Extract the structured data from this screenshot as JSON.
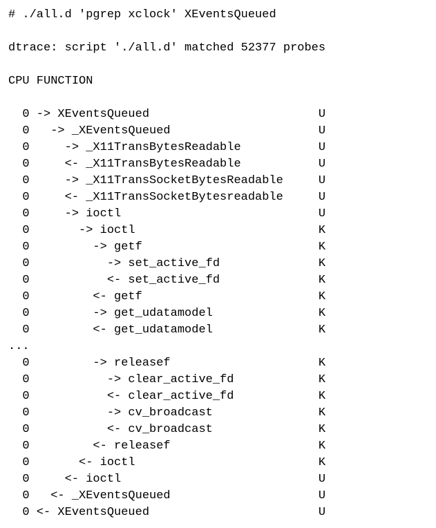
{
  "command_line": "# ./all.d 'pgrep xclock' XEventsQueued",
  "dtrace_line": "dtrace: script './all.d' matched 52377 probes",
  "header": "CPU FUNCTION",
  "ellipsis": "...",
  "trace_rows": [
    {
      "cpu": "0",
      "dir": "->",
      "depth": 0,
      "name": "XEventsQueued",
      "tag": "U"
    },
    {
      "cpu": "0",
      "dir": "->",
      "depth": 1,
      "name": "_XEventsQueued",
      "tag": "U"
    },
    {
      "cpu": "0",
      "dir": "->",
      "depth": 2,
      "name": "_X11TransBytesReadable",
      "tag": "U"
    },
    {
      "cpu": "0",
      "dir": "<-",
      "depth": 2,
      "name": "_X11TransBytesReadable",
      "tag": "U"
    },
    {
      "cpu": "0",
      "dir": "->",
      "depth": 2,
      "name": "_X11TransSocketBytesReadable",
      "tag": "U"
    },
    {
      "cpu": "0",
      "dir": "<-",
      "depth": 2,
      "name": "_X11TransSocketBytesreadable",
      "tag": "U"
    },
    {
      "cpu": "0",
      "dir": "->",
      "depth": 2,
      "name": "ioctl",
      "tag": "U"
    },
    {
      "cpu": "0",
      "dir": "->",
      "depth": 3,
      "name": "ioctl",
      "tag": "K"
    },
    {
      "cpu": "0",
      "dir": "->",
      "depth": 4,
      "name": "getf",
      "tag": "K"
    },
    {
      "cpu": "0",
      "dir": "->",
      "depth": 5,
      "name": "set_active_fd",
      "tag": "K"
    },
    {
      "cpu": "0",
      "dir": "<-",
      "depth": 5,
      "name": "set_active_fd",
      "tag": "K"
    },
    {
      "cpu": "0",
      "dir": "<-",
      "depth": 4,
      "name": "getf",
      "tag": "K"
    },
    {
      "cpu": "0",
      "dir": "->",
      "depth": 4,
      "name": "get_udatamodel",
      "tag": "K"
    },
    {
      "cpu": "0",
      "dir": "<-",
      "depth": 4,
      "name": "get_udatamodel",
      "tag": "K"
    },
    {
      "ellipsis": true
    },
    {
      "cpu": "0",
      "dir": "->",
      "depth": 4,
      "name": "releasef",
      "tag": "K"
    },
    {
      "cpu": "0",
      "dir": "->",
      "depth": 5,
      "name": "clear_active_fd",
      "tag": "K"
    },
    {
      "cpu": "0",
      "dir": "<-",
      "depth": 5,
      "name": "clear_active_fd",
      "tag": "K"
    },
    {
      "cpu": "0",
      "dir": "->",
      "depth": 5,
      "name": "cv_broadcast",
      "tag": "K"
    },
    {
      "cpu": "0",
      "dir": "<-",
      "depth": 5,
      "name": "cv_broadcast",
      "tag": "K"
    },
    {
      "cpu": "0",
      "dir": "<-",
      "depth": 4,
      "name": "releasef",
      "tag": "K"
    },
    {
      "cpu": "0",
      "dir": "<-",
      "depth": 3,
      "name": "ioctl",
      "tag": "K"
    },
    {
      "cpu": "0",
      "dir": "<-",
      "depth": 2,
      "name": "ioctl",
      "tag": "U"
    },
    {
      "cpu": "0",
      "dir": "<-",
      "depth": 1,
      "name": "_XEventsQueued",
      "tag": "U"
    },
    {
      "cpu": "0",
      "dir": "<-",
      "depth": 0,
      "name": "XEventsQueued",
      "tag": "U"
    }
  ],
  "layout": {
    "cpu_col_width": 3,
    "body_col_width": 40,
    "indent_step": 2
  }
}
